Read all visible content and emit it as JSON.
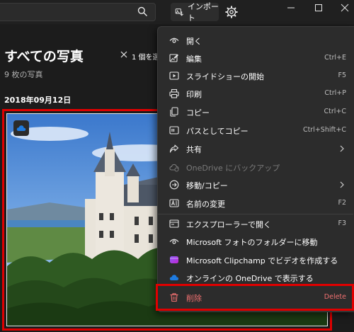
{
  "toolbar": {
    "import_label": "インポート",
    "search_icon": "search-icon",
    "settings_icon": "gear-icon"
  },
  "window_controls": [
    "minimize",
    "maximize",
    "close"
  ],
  "gallery": {
    "title": "すべての写真",
    "subtitle": "9 枚の写真",
    "selection_text": "1 個を選",
    "date_header": "2018年09月12日",
    "photo_badge_icon": "onedrive-cloud-icon"
  },
  "menu": {
    "items": [
      {
        "label": "開く",
        "shortcut": "",
        "icon": "eye-icon"
      },
      {
        "label": "編集",
        "shortcut": "Ctrl+E",
        "icon": "edit-image-icon"
      },
      {
        "label": "スライドショーの開始",
        "shortcut": "F5",
        "icon": "slideshow-icon"
      },
      {
        "label": "印刷",
        "shortcut": "Ctrl+P",
        "icon": "printer-icon"
      },
      {
        "label": "コピー",
        "shortcut": "Ctrl+C",
        "icon": "copy-icon"
      },
      {
        "label": "パスとしてコピー",
        "shortcut": "Ctrl+Shift+C",
        "icon": "copy-path-icon"
      },
      {
        "label": "共有",
        "shortcut": "",
        "icon": "share-icon"
      },
      {
        "label": "OneDrive にバックアップ",
        "shortcut": "",
        "icon": "cloud-sync-icon"
      },
      {
        "label": "移動/コピー",
        "shortcut": "",
        "icon": "move-icon"
      },
      {
        "label": "名前の変更",
        "shortcut": "F2",
        "icon": "rename-icon"
      },
      {
        "label": "エクスプローラーで開く",
        "shortcut": "F3",
        "icon": "explorer-icon"
      },
      {
        "label": "Microsoft フォトのフォルダーに移動",
        "shortcut": "",
        "icon": "eye-icon"
      },
      {
        "label": "Microsoft Clipchamp でビデオを作成する",
        "shortcut": "",
        "icon": "clipchamp-icon"
      },
      {
        "label": "オンラインの OneDrive で表示する",
        "shortcut": "",
        "icon": "onedrive-icon"
      },
      {
        "label": "削除",
        "shortcut": "Delete",
        "icon": "trash-icon"
      }
    ]
  },
  "colors": {
    "background": "#1c1c1c",
    "menu_background": "#2c2c2c",
    "highlight_frame": "#e00000",
    "delete_text": "#f07070",
    "disabled_text": "#7a7a7a"
  }
}
